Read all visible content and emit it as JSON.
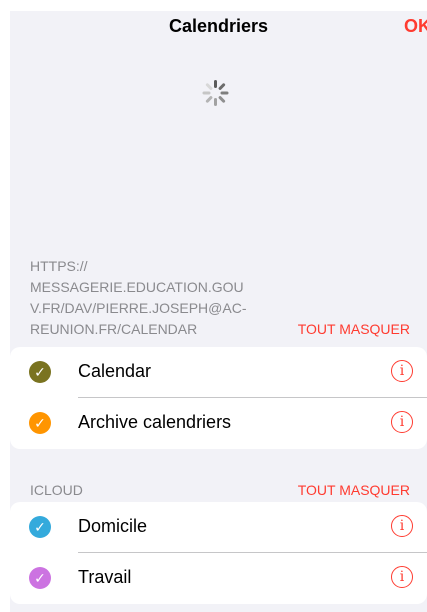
{
  "nav": {
    "title": "Calendriers",
    "done": "OK"
  },
  "groups": [
    {
      "header": "HTTPS://\nMESSAGERIE.EDUCATION.GOU\nV.FR/DAV/PIERRE.JOSEPH@AC-\nREUNION.FR/CALENDAR",
      "action": "TOUT MASQUER",
      "items": [
        {
          "label": "Calendar",
          "color": "#7a7320",
          "checked": true
        },
        {
          "label": "Archive calendriers",
          "color": "#ff9500",
          "checked": true
        }
      ]
    },
    {
      "header": "ICLOUD",
      "action": "TOUT MASQUER",
      "items": [
        {
          "label": "Domicile",
          "color": "#34aadc",
          "checked": true
        },
        {
          "label": "Travail",
          "color": "#cc73e1",
          "checked": true
        }
      ]
    }
  ],
  "icons": {
    "check": "checkmark-icon",
    "info": "info-icon",
    "loading": "spinner-icon"
  },
  "colors": {
    "accent": "#ff3b30",
    "background": "#f2f2f7",
    "secondary_text": "#8a8a8e"
  }
}
